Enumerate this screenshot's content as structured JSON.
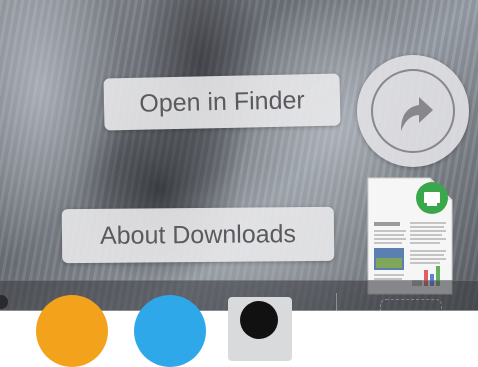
{
  "stack_menu": {
    "open_in_finder_label": "Open in Finder",
    "about_downloads_label": "About Downloads"
  },
  "icons": {
    "open_arrow": "curved-arrow-icon",
    "document": "document-thumbnail-icon"
  },
  "colors": {
    "button_bg": "#e8e8ea",
    "button_text": "#5a5a5e",
    "arrow": "#88888c",
    "doc_accent": "#3aa84a"
  }
}
